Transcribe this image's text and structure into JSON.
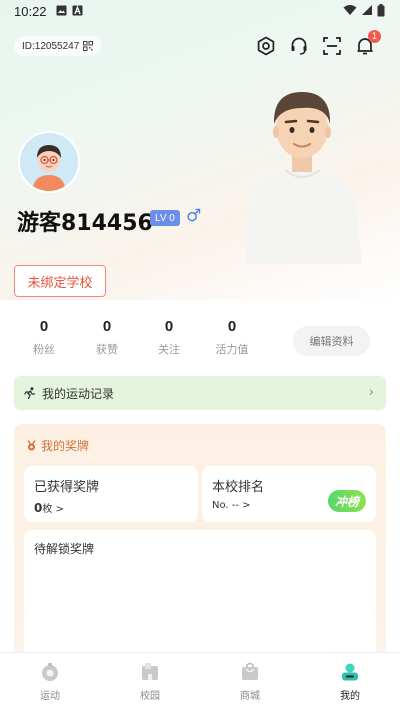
{
  "status_bar": {
    "time": "10:22"
  },
  "header": {
    "user_id": "ID:12055247",
    "notification_count": "1"
  },
  "profile": {
    "nickname": "游客814456",
    "level": "LV 0",
    "gender_symbol": "♂"
  },
  "school_button": "未绑定学校",
  "stats": [
    {
      "value": "0",
      "label": "粉丝"
    },
    {
      "value": "0",
      "label": "获赞"
    },
    {
      "value": "0",
      "label": "关注"
    },
    {
      "value": "0",
      "label": "活力值"
    }
  ],
  "edit_profile": "编辑资料",
  "sport_record": {
    "label": "我的运动记录",
    "chevron": "›"
  },
  "medals": {
    "title": "我的奖牌",
    "earned": {
      "title": "已获得奖牌",
      "count": "0",
      "unit": "枚 >"
    },
    "ranking": {
      "title": "本校排名",
      "value": "No. -- >",
      "tag": "冲榜"
    },
    "locked": {
      "title": "待解锁奖牌"
    }
  },
  "bottom_nav": [
    {
      "label": "运动",
      "icon": "sport-icon"
    },
    {
      "label": "校园",
      "icon": "campus-icon"
    },
    {
      "label": "商城",
      "icon": "mall-icon"
    },
    {
      "label": "我的",
      "icon": "mine-icon"
    }
  ],
  "colors": {
    "accent_red": "#e8533f",
    "level_blue": "#6b8fe8",
    "record_green": "#e5f4dd",
    "medal_orange": "#d2733f"
  }
}
